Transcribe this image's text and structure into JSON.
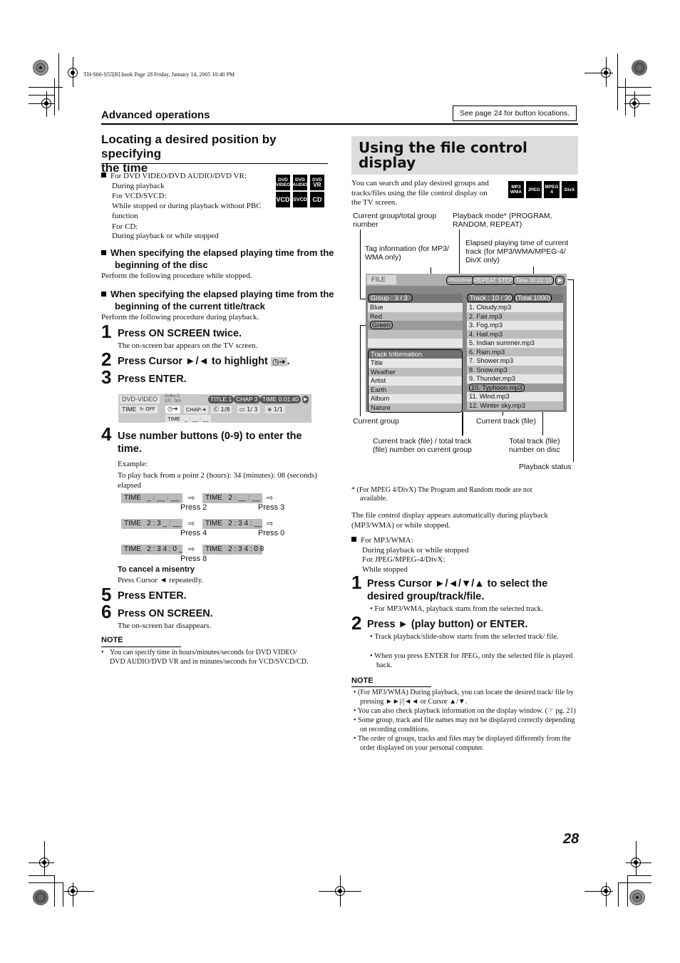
{
  "print_header": "TH-S66-S55[B].book  Page 28  Friday, January 14, 2005  10:40 PM",
  "section_label": "Advanced operations",
  "see_page_box": "See page 24 for button locations.",
  "page_number": "28",
  "left": {
    "title_line1": "Locating a desired position by specifying",
    "title_line2": "the time",
    "conditions": [
      "For DVD VIDEO/DVD AUDIO/DVD VR:",
      "During playback",
      "For VCD/SVCD:",
      "While stopped or during playback without PBC",
      "function",
      "For CD:",
      "During playback or while stopped"
    ],
    "disc_badges": [
      {
        "line1": "DVD",
        "line2": "VIDEO"
      },
      {
        "line1": "DVD",
        "line2": "AUDIO"
      },
      {
        "line1": "DVD",
        "line2": "VR"
      },
      {
        "line1": "VCD",
        "line2": ""
      },
      {
        "line1": "SVCD",
        "line2": ""
      },
      {
        "line1": "CD",
        "line2": ""
      }
    ],
    "sub1_line1": "When specifying the elapsed playing time from the",
    "sub1_line2": "beginning of the disc",
    "sub1_note": "Perform the following procedure while stopped.",
    "sub2_line1": "When specifying the elapsed playing time from the",
    "sub2_line2": "beginning of the current title/track",
    "sub2_note": "Perform the following procedure during playback.",
    "steps": [
      {
        "num": "1",
        "title": "Press ON SCREEN twice.",
        "desc": "The on-screen bar appears on the TV screen."
      },
      {
        "num": "2",
        "title": "Press Cursor ►/◄ to highlight",
        "icon_label": "◷➜",
        "tail": "."
      },
      {
        "num": "3",
        "title": "Press ENTER."
      },
      {
        "num": "4",
        "title_line1": "Use number buttons (0-9) to enter the",
        "title_line2": "time."
      },
      {
        "num": "5",
        "title": "Press ENTER."
      },
      {
        "num": "6",
        "title": "Press ON SCREEN.",
        "desc": "The on-screen bar disappears."
      }
    ],
    "osd": {
      "mode": "DVD-VIDEO",
      "audio_line1": "Dolby D",
      "audio_line2": "2/0 . 0ch",
      "title": "TITLE  1",
      "chap": "CHAP  3",
      "time": "TIME   0:01:40",
      "play_icon": "▶",
      "time_label": "TIME",
      "repeat": "↻ OFF",
      "time_search": "◷➜",
      "chap_search": "CHAP.➜",
      "audio_track": "Ⓒ 1/8",
      "subtitle": "▭ 1/  3",
      "angle": "⎈ 1/1",
      "time_entry": "TIME   _ : __ : __"
    },
    "example_label": "Example:",
    "example_text": "To play back from a point 2 (hours): 34 (minutes): 08 (seconds) elapsed",
    "sequence": [
      {
        "from": "TIME   _ : __ : __",
        "to": "TIME   2 : __ : __",
        "press_a": "Press 2",
        "press_b": "Press 3"
      },
      {
        "from": "TIME   2 : 3 _ : __",
        "to": "TIME   2 : 3 4 : __",
        "press_a": "Press 4",
        "press_b": "Press 0"
      },
      {
        "from": "TIME   2 : 3 4 : 0 _",
        "to": "TIME   2 : 3 4 : 0 8",
        "press_a": "Press 8",
        "press_b": ""
      }
    ],
    "arrow_glyph": "⇨",
    "cancel_head": "To cancel a misentry",
    "cancel_text": "Press Cursor ◄ repeatedly.",
    "note_label": "NOTE",
    "note_line1": "You can specify time in hours/minutes/seconds for DVD VIDEO/",
    "note_line2": "DVD AUDIO/DVD VR and in minutes/seconds for VCD/SVCD/CD."
  },
  "right": {
    "title_line1": "Using the file control",
    "title_line2": "display",
    "intro": [
      "You can search and play desired groups and",
      "tracks/files using the file control display on",
      "the TV screen."
    ],
    "format_badges": [
      {
        "line1": "MP3",
        "line2": "WMA"
      },
      {
        "line1": "JPEG",
        "line2": ""
      },
      {
        "line1": "MPEG",
        "line2": "4"
      },
      {
        "line1": "DivX",
        "line2": ""
      }
    ],
    "callouts": {
      "group_total_1": "Current group/total group",
      "group_total_2": "number",
      "playmode_1": "Playback mode* (PROGRAM,",
      "playmode_2": "RANDOM, REPEAT)",
      "tag_1": "Tag information (for MP3/",
      "tag_2": "WMA only)",
      "elapsed_1": "Elapsed playing time of current",
      "elapsed_2": "track (for MP3/WMA/MPEG-4/",
      "elapsed_3": "DivX only)",
      "current_group": "Current group",
      "current_track": "Current track (file)",
      "track_total_1": "Current track (file) / total track",
      "track_total_2": "(file) number on current group",
      "disc_total_1": "Total track (file)",
      "disc_total_2": "number on disc",
      "play_status": "Playback status"
    },
    "file_display": {
      "file_label": "FILE",
      "program": "PROGRAM",
      "repeat": "REPEAT STEP",
      "time": "Time 00:02:15",
      "play_icon": "▶",
      "group_header": "Group  :   3  /  3",
      "groups": [
        "Blue",
        "Red",
        "Green",
        "",
        ""
      ],
      "current_group_index": 2,
      "track_info_header": "Track  Information",
      "track_info": [
        "Title",
        "Weather",
        "Artist",
        "Earth",
        "Album",
        "Nature"
      ],
      "track_header": "Track  :  10  /  30",
      "total_header": "(Total  1000)",
      "tracks": [
        "1. Cloudy.mp3",
        "2. Fair.mp3",
        "3. Fog.mp3",
        "4. Hail.mp3",
        "5. Indian summer.mp3",
        "6. Rain.mp3",
        "7. Shower.mp3",
        "8. Snow.mp3",
        "9. Thunder.mp3",
        "10. Typhoon.mp3",
        "11. Wind.mp3",
        "12. Winter sky.mp3"
      ],
      "current_track_index": 9
    },
    "footnote_1": "*  (For MPEG 4/DivX) The Program and Random mode are not",
    "footnote_2": "available.",
    "auto_text_1": "The file control display appears automatically during playback",
    "auto_text_2": "(MP3/WMA) or while stopped.",
    "conditions": [
      "For MP3/WMA:",
      "During playback or while stopped",
      "For JPEG/MPEG-4/DivX:",
      "While stopped"
    ],
    "steps": [
      {
        "num": "1",
        "title_line1": "Press Cursor ►/◄/▼/▲ to select the",
        "title_line2": "desired group/track/file.",
        "bullets": [
          "For MP3/WMA, playback starts from the selected track."
        ]
      },
      {
        "num": "2",
        "title": "Press ► (play button) or ENTER.",
        "bullets": [
          "Track playback/slide-show starts from the selected track/ file.",
          "When you press ENTER for JPEG, only the selected file is played back."
        ]
      }
    ],
    "note_label": "NOTE",
    "notes": [
      "(For MP3/WMA) During playback, you can locate the desired track/ file by pressing ►►|/|◄◄ or Cursor ▲/▼.",
      "You can also check playback information on the display window. (☞ pg. 21)",
      "Some group, track and file names may not be displayed correctly depending on recording conditions.",
      "The order of groups, tracks and files may be displayed differently from the order displayed on your personal computer."
    ]
  }
}
